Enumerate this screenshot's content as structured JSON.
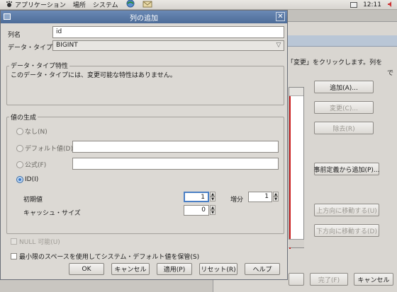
{
  "panel": {
    "applications": "アプリケーション",
    "places": "場所",
    "system": "システム",
    "clock": "12:11"
  },
  "background_window": {
    "instruction_text": "「変更」をクリックします。列を",
    "instruction_suffix": "で",
    "buttons": {
      "add": "追加(A)...",
      "change": "変更(C)...",
      "remove": "除去(R)",
      "add_predefined": "事前定義から追加(P)...",
      "move_up": "上方向に移動する(U)",
      "move_down": "下方向に移動する(D)",
      "finish": "完了(F)",
      "cancel": "キャンセル"
    }
  },
  "dialog": {
    "title": "列の追加",
    "column_name_label": "列名",
    "column_name_value": "id",
    "datatype_label": "データ・タイプ",
    "datatype_value": "BIGINT",
    "datatype_props_title": "データ・タイプ特性",
    "datatype_props_text": "このデータ・タイプには、変更可能な特性はありません。",
    "value_gen_title": "値の生成",
    "radio_none": "なし(N)",
    "radio_default": "デフォルト値(D)",
    "radio_formula": "公式(F)",
    "radio_id": "ID(I)",
    "initial_value_label": "初期値",
    "initial_value": "1",
    "increment_label": "増分",
    "increment_value": "1",
    "cache_size_label": "キャッシュ・サイズ",
    "cache_size_value": "0",
    "nullable_label": "NULL 可能(U)",
    "min_space_label": "最小限のスペースを使用してシステム・デフォルト値を保管(S)",
    "buttons": {
      "ok": "OK",
      "cancel": "キャンセル",
      "apply": "適用(P)",
      "reset": "リセット(R)",
      "help": "ヘルプ"
    }
  },
  "colors": {
    "title_bar": "#5a79a7",
    "focus_ring": "#4a7fc5",
    "background": "#dcd9d4"
  }
}
